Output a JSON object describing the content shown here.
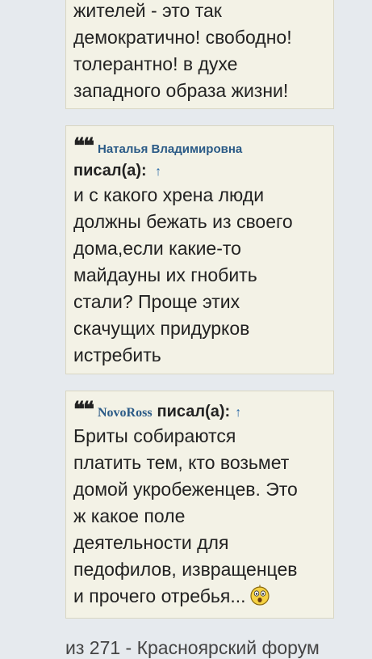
{
  "quote1": {
    "text": "жителей - это так\nдемократично! свободно!\nтолерантно! в духе\nзападного образа жизни!"
  },
  "quote2": {
    "author": "Наталья Владимировна",
    "wrote": "писал(а):",
    "up_icon": "↑",
    "text": "и с какого хрена люди\nдолжны бежать из своего\nдома,если какие-то\nмайдауны их гнобить\nстали? Проще этих\nскачущих придурков\nистребить"
  },
  "quote3": {
    "author": "NovoRoss",
    "wrote": "писал(а):",
    "up_icon": "↑",
    "text": "Бриты собираются\nплатить тем, кто возьмет\nдомой укробеженцев. Это\nж какое поле\nдеятельности для\nпедофилов, извращенцев\nи прочего отребья...",
    "emoji": "shocked-smiley-icon"
  },
  "footer": {
    "text": "из 271 - Красноярский форум"
  },
  "colors": {
    "page_bg": "#e6eaee",
    "quote_bg": "#f3f2e6",
    "author": "#2a5a86",
    "link": "#2a6aa8"
  }
}
